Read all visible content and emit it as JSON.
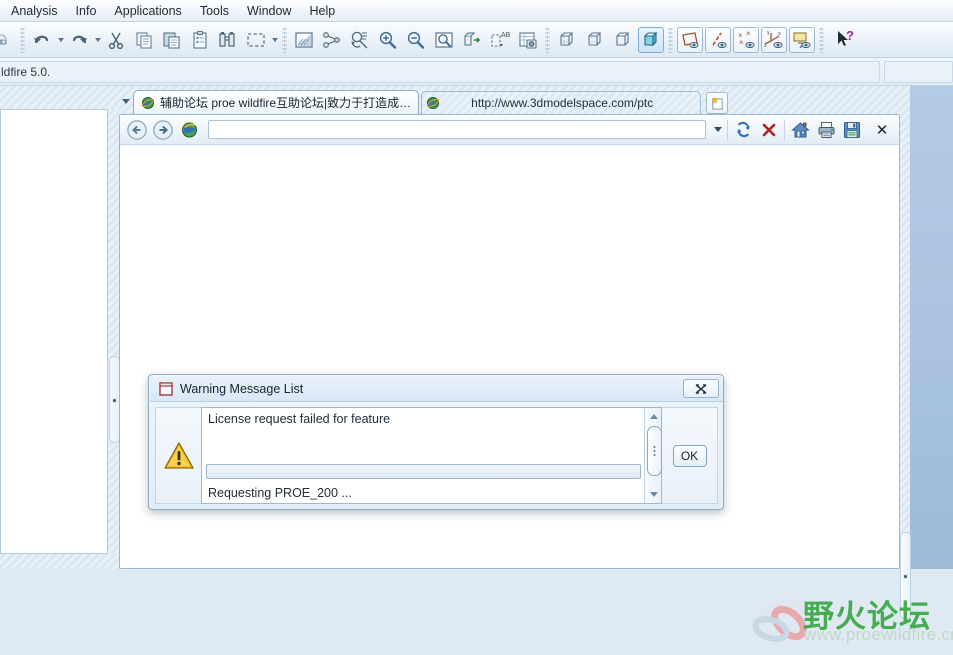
{
  "menu": {
    "items": [
      {
        "label": "Analysis",
        "name": "menu-analysis"
      },
      {
        "label": "Info",
        "name": "menu-info"
      },
      {
        "label": "Applications",
        "name": "menu-applications"
      },
      {
        "label": "Tools",
        "name": "menu-tools"
      },
      {
        "label": "Window",
        "name": "menu-window"
      },
      {
        "label": "Help",
        "name": "menu-help"
      }
    ]
  },
  "toolbar": {
    "icons": [
      "model-tree-icon",
      "undo-icon",
      "undo-dropdown-icon",
      "redo-icon",
      "redo-dropdown-icon",
      "cut-icon",
      "copy-icon",
      "paste-icon",
      "paste-special-icon",
      "find-icon",
      "select-region-icon",
      "select-dropdown-icon",
      "repaint-icon",
      "datum-display-icon",
      "spin-center-icon",
      "zoom-in-icon",
      "zoom-out-icon",
      "refit-icon",
      "saved-view-icon",
      "annotation-icon",
      "layer-icon",
      "wireframe-icon",
      "hidden-line-icon",
      "no-hidden-icon",
      "shading-icon",
      "datum-plane-icon",
      "datum-axis-icon",
      "datum-point-icon",
      "datum-csys-icon",
      "annotation-display-icon",
      "context-help-icon"
    ]
  },
  "status": {
    "message": "ldfire 5.0."
  },
  "browser": {
    "tabs": [
      {
        "label": "辅助论坛 proe wildfire互助论坛|致力于打造成…",
        "icon": "browser-globe-icon",
        "active": true
      },
      {
        "label": "http://www.3dmodelspace.com/ptc",
        "icon": "browser-globe-icon",
        "active": false
      }
    ],
    "new_tab_icon": "new-tab-icon",
    "nav": {
      "back_icon": "back-arrow-icon",
      "forward_icon": "forward-arrow-icon",
      "globe_icon": "browser-home-globe-icon",
      "refresh_icon": "refresh-icon",
      "stop_icon": "stop-icon",
      "home_icon": "home-icon",
      "print_icon": "print-icon",
      "save_icon": "save-icon",
      "close_icon": "close-icon"
    },
    "address": {
      "value": "",
      "placeholder": ""
    }
  },
  "dialog": {
    "title": "Warning Message List",
    "title_icon": "window-icon",
    "close_icon": "dialog-close-icon",
    "warning_icon": "warning-triangle-icon",
    "messages": [
      "License request failed for feature",
      "Requesting PROE_200 ..."
    ],
    "ok_label": "OK"
  },
  "watermark": {
    "title": "野火论坛",
    "url": "www.proewildfire.cn",
    "logo_icon": "flame-logo-icon",
    "color": "#3aa845"
  },
  "colors": {
    "graphics_background": "#a9c3df",
    "chrome": "#e4edf6",
    "accent": "#7eaed6",
    "warning": "#f0b400"
  }
}
